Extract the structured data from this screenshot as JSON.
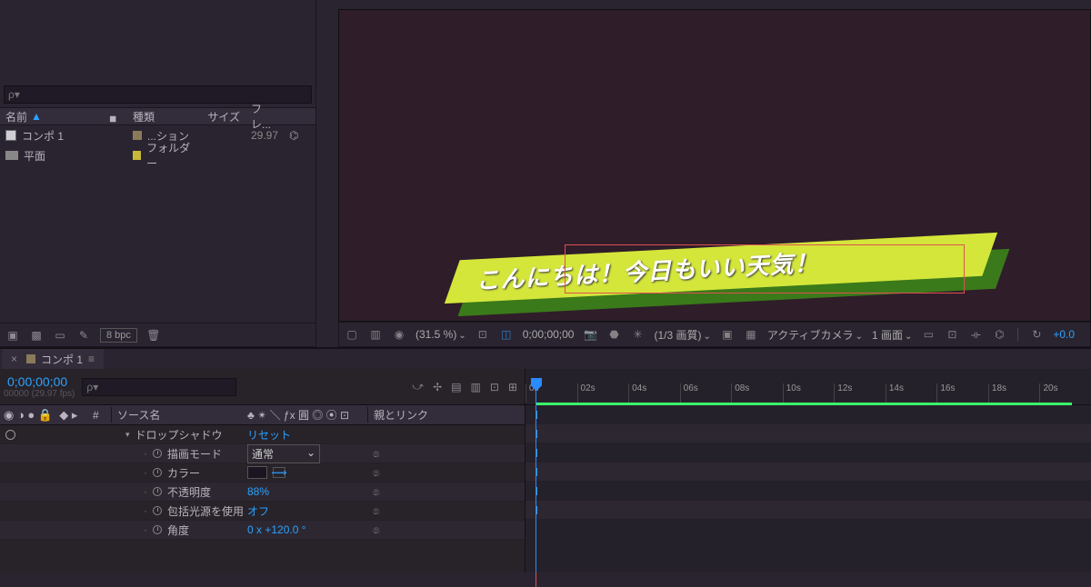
{
  "project": {
    "search_placeholder": "ρ▾",
    "headers": {
      "name": "名前",
      "tag": "◆",
      "type": "種類",
      "size": "サイズ",
      "fr": "フレ..."
    },
    "rows": [
      {
        "name": "コンポ 1",
        "type": "...ション",
        "size": "",
        "fr": "29.97",
        "tag": "brown",
        "icon": "comp"
      },
      {
        "name": "平面",
        "type": "フォルダー",
        "size": "",
        "fr": "",
        "tag": "yellow",
        "icon": "folder"
      }
    ],
    "bpc": "8 bpc"
  },
  "viewer": {
    "caption_text": "こんにちは！今日もいい天気！",
    "toolbar": {
      "pct": "(31.5 %)",
      "tc": "0;00;00;00",
      "quality": "(1/3 画質)",
      "camera": "アクティブカメラ",
      "views": "1 画面",
      "exposure": "+0.0"
    }
  },
  "timeline": {
    "tab": "コンポ 1",
    "time": "0;00;00;00",
    "frame_info": "00000 (29.97 fps)",
    "search_placeholder": "ρ▾",
    "cols": {
      "hash": "#",
      "source": "ソース名",
      "switches": "♣ ✴ ＼ ƒx 圓 ◎ ⦿ ⊡",
      "parent": "親とリンク"
    },
    "effect": {
      "label": "ドロップシャドウ",
      "reset": "リセット",
      "props": {
        "mode_l": "描画モード",
        "mode_v": "通常",
        "color_l": "カラー",
        "opacity_l": "不透明度",
        "opacity_v": "88%",
        "global_l": "包括光源を使用",
        "global_v": "オフ",
        "angle_l": "角度",
        "angle_v": "0 x +120.0 °"
      }
    },
    "ticks": [
      "0s",
      "02s",
      "04s",
      "06s",
      "08s",
      "10s",
      "12s",
      "14s",
      "16s",
      "18s",
      "20s"
    ]
  }
}
